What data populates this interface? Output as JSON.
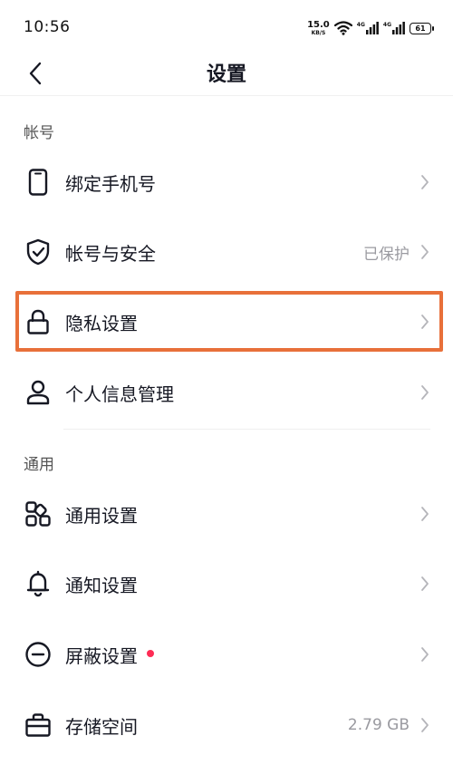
{
  "status": {
    "time": "10:56",
    "net_speed_value": "15.0",
    "net_speed_unit": "KB/S",
    "sim1_tag": "4G",
    "sim2_tag": "4G",
    "battery": "61"
  },
  "header": {
    "title": "设置"
  },
  "sections": {
    "account": {
      "title": "帐号",
      "items": [
        {
          "label": "绑定手机号",
          "icon": "phone-icon",
          "value": ""
        },
        {
          "label": "帐号与安全",
          "icon": "shield-check-icon",
          "value": "已保护"
        },
        {
          "label": "隐私设置",
          "icon": "lock-icon",
          "value": ""
        },
        {
          "label": "个人信息管理",
          "icon": "person-icon",
          "value": ""
        }
      ]
    },
    "general": {
      "title": "通用",
      "items": [
        {
          "label": "通用设置",
          "icon": "grid-icon",
          "value": ""
        },
        {
          "label": "通知设置",
          "icon": "bell-icon",
          "value": ""
        },
        {
          "label": "屏蔽设置",
          "icon": "minus-circle-icon",
          "value": "",
          "badge": "red-dot"
        },
        {
          "label": "存储空间",
          "icon": "storage-box-icon",
          "value": "2.79 GB"
        }
      ]
    }
  },
  "colors": {
    "highlight": "#e8703a",
    "badge_dot": "#fe2c55",
    "text_primary": "#161823",
    "text_secondary": "#9a9aa0",
    "chevron": "#b5b5ba"
  }
}
